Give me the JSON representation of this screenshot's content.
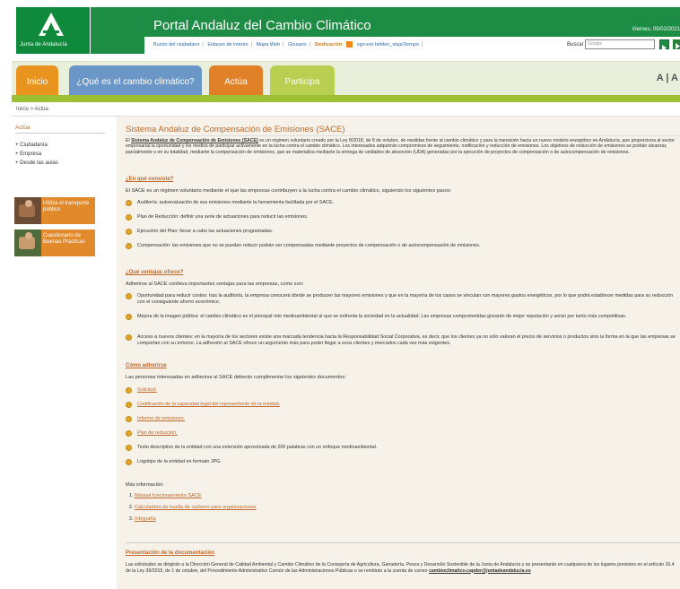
{
  "header": {
    "logo_text": "Junta de Andalucía",
    "portal_title": "Portal Andaluz del Cambio Climático",
    "date": "Viernes, 05/02/2021",
    "util_links": [
      "Buzón del ciudadano",
      "Enlaces de interés",
      "Mapa Web",
      "Glosario"
    ],
    "sindicacion": "Sindicación",
    "widget_text": "sgn-ext-hidden_viajaTiempo",
    "search_label": "Buscar",
    "search_placeholder": "Google",
    "colors": {
      "brand_green": "#1d8c45",
      "accent_orange": "#e08128"
    }
  },
  "nav": {
    "tabs": [
      {
        "label": "Inicio"
      },
      {
        "label": "¿Qué es el cambio climático?"
      },
      {
        "label": "Actúa"
      },
      {
        "label": "Participa"
      }
    ],
    "font_size_control": "A | A"
  },
  "breadcrumb": "Inicio > Actúa",
  "sidebar": {
    "title": "Actúa",
    "items": [
      {
        "label": "Ciudadanía"
      },
      {
        "label": "Empresa"
      },
      {
        "label": "Desde las aulas"
      }
    ],
    "promos": [
      {
        "label": "Utiliza el transporte público"
      },
      {
        "label": "Cuestionario de Buenas Prácticas"
      }
    ]
  },
  "content": {
    "title": "Sistema Andaluz de Compensación de Emisiones (SACE)",
    "intro_prefix": "El",
    "intro_name": "Sistema Andaluz de Compensación de Emisiones (SACE)",
    "intro_rest": "es un régimen voluntario creado por la Ley 8/2018, de 8 de octubre, de medidas frente al cambio climático y para la transición hacia un nuevo modelo energético en Andalucía, que proporciona al sector empresarial la oportunidad y los medios de participar activamente en la lucha contra el cambio climático. Los interesados adquirirán compromisos de seguimiento, notificación y reducción de emisiones. Los objetivos de reducción de emisiones se podrán alcanzar, parcialmente o en su totalidad, mediante la compensación de emisiones, que se materializa mediante la entrega de unidades de absorción (UDA) generadas por la ejecución de proyectos de compensación o de autocompensación de emisiones.",
    "s1": {
      "heading": "¿En qué consiste?",
      "text": "El SACE es un régimen voluntario mediante el que las empresas contribuyen a la lucha contra el cambio climático, siguiendo los siguientes pasos:",
      "bullets": [
        "Auditoría: autoevaluación de sus emisiones mediante la herramienta facilitada por el SACE.",
        "Plan de Reducción: definir una serie de actuaciones para reducir las emisiones.",
        "Ejecución del Plan: llevar a cabo las actuaciones programadas.",
        "Compensación: las emisiones que no se puedan reducir podrán ser compensadas mediante proyectos de compensación o de autocompensación de emisiones."
      ]
    },
    "s2": {
      "heading": "¿Qué ventajas ofrece?",
      "text": "Adherirse al SACE conlleva importantes ventajas para las empresas, como son:",
      "bullets": [
        "Oportunidad para reducir costes: tras la auditoría, la empresa conocerá dónde se producen las mayores emisiones y que en la mayoría de los casos se vinculan con mayores gastos energéticos, por lo que podrá establecer medidas para su reducción con el consiguiente ahorro económico.",
        "Mejora de la imagen pública: el cambio climático es el principal reto medioambiental al que se enfrenta la sociedad en la actualidad. Las empresas comprometidas gozarán de mejor reputación y serán por tanto más competitivas.",
        "Acceso a nuevos clientes: en la mayoría de los sectores existe una marcada tendencia hacia la Responsabilidad Social Corporativa, es decir, que los clientes ya no sólo valoran el precio de servicios o productos sino la forma en la que las empresas se comportan con su entorno. La adhesión al SACE ofrece un argumento más para poder llegar a esos clientes y mercados cada vez más exigentes."
      ]
    },
    "s3": {
      "heading": "Cómo adherirse",
      "text": "Las personas interesadas en adherirse al SACE deberán cumplimentar los siguientes documentos:",
      "bullets": [
        "Solicitud.",
        "Certificación de la capacidad legal del representante de la entidad.",
        "Informe de emisiones.",
        "Plan de reducción.",
        "Texto descriptivo de la entidad con una extensión aproximada de 200 palabras con un enfoque medioambiental.",
        "Logotipo de la entidad en formato JPG."
      ],
      "more_info": "Más información:",
      "more_links": [
        "Manual funcionamiento SACE",
        "Calculadora de huella de carbono para organizaciones",
        "Infografía"
      ]
    },
    "s4": {
      "heading": "Presentación de la documentación",
      "text": "Las solicitudes se dirigirán a la Dirección General de Calidad Ambiental y Cambio Climático de la Consejería de Agricultura, Ganadería, Pesca y Desarrollo Sostenible de la Junta de Andalucía y se presentarán en cualquiera de los lugares previstos en el artículo 16.4 de la Ley 39/2015, de 1 de octubre, del Procedimiento Administrativo Común de las Administraciones Públicas o se remitirán a la cuenta de correo",
      "email": "cambioclimatico.capder@juntadeandalucia.es"
    }
  }
}
